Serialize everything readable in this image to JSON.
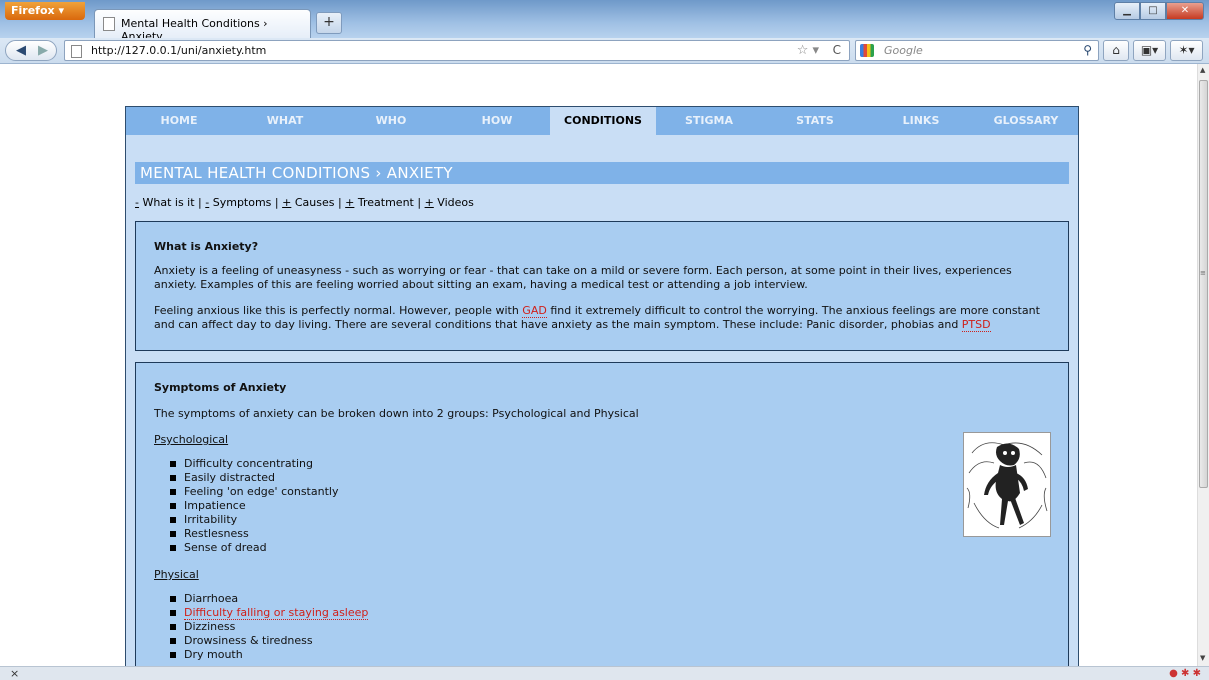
{
  "browser": {
    "firefox_button": "Firefox",
    "tab_title": "Mental Health Conditions › Anxiety",
    "new_tab": "+",
    "url": "http://127.0.0.1/uni/anxiety.htm",
    "search_placeholder": "Google",
    "status_close": "×"
  },
  "site": {
    "nav": [
      "HOME",
      "WHAT",
      "WHO",
      "HOW",
      "CONDITIONS",
      "STIGMA",
      "STATS",
      "LINKS",
      "GLOSSARY"
    ],
    "active_nav": "CONDITIONS",
    "page_heading": "MENTAL HEALTH CONDITIONS › ANXIETY",
    "section_links": [
      {
        "marker": "-",
        "label": "What is it"
      },
      {
        "marker": "-",
        "label": "Symptoms"
      },
      {
        "marker": "+",
        "label": "Causes"
      },
      {
        "marker": "+",
        "label": "Treatment"
      },
      {
        "marker": "+",
        "label": "Videos"
      }
    ],
    "what_is": {
      "heading": "What is Anxiety?",
      "para1": "Anxiety is a feeling of uneasyness - such as worrying or fear - that can take on a mild or severe form. Each person, at some point in their lives, experiences anxiety. Examples of this are feeling worried about sitting an exam, having a medical test or attending a job interview.",
      "para2_before": "Feeling anxious like this is perfectly normal. However, people with ",
      "para2_link1": "GAD",
      "para2_middle": " find it extremely difficult to control the worrying. The anxious feelings are more constant and can affect day to day living. There are several conditions that have anxiety as the main symptom. These include: Panic disorder, phobias and ",
      "para2_link2": "PTSD"
    },
    "symptoms": {
      "heading": "Symptoms of Anxiety",
      "intro": "The symptoms of anxiety can be broken down into 2 groups: Psychological and Physical",
      "psych_heading": "Psychological",
      "psych_items": [
        "Difficulty concentrating",
        "Easily distracted",
        "Feeling 'on edge' constantly",
        "Impatience",
        "Irritability",
        "Restlesness",
        "Sense of dread"
      ],
      "phys_heading": "Physical",
      "phys_items": [
        "Diarrhoea",
        "Difficulty falling or staying asleep",
        "Dizziness",
        "Drowsiness & tiredness",
        "Dry mouth"
      ],
      "phys_link_item": "Difficulty falling or staying asleep"
    }
  },
  "colors": {
    "nav_bg": "#7fb2e8",
    "page_bg": "#c9def5",
    "box_bg": "#a9cdf1",
    "link_red": "#d0201a"
  }
}
